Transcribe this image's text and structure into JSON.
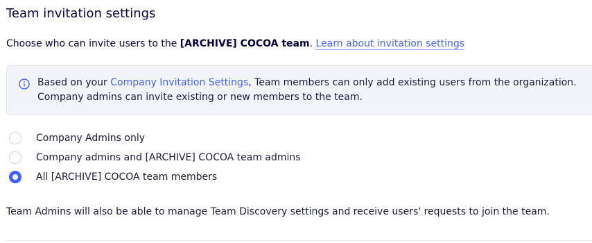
{
  "section": {
    "title": "Team invitation settings"
  },
  "description": {
    "prefix": "Choose who can invite users to the ",
    "team_name": "[ARCHIVE] COCOA team",
    "period": ".",
    "link_label": "Learn about invitation settings"
  },
  "info": {
    "icon": "info-icon",
    "prefix": "Based on your ",
    "link_label": "Company Invitation Settings",
    "suffix": ", Team members can only add existing users from the organization. Company admins can invite existing or new members to the team."
  },
  "options": [
    {
      "label": "Company Admins only",
      "selected": false
    },
    {
      "label": "Company admins and [ARCHIVE] COCOA team admins",
      "selected": false
    },
    {
      "label": "All [ARCHIVE] COCOA team members",
      "selected": true
    }
  ],
  "footer": {
    "note": "Team Admins will also be able to manage Team Discovery settings and receive users' requests to join the team."
  },
  "colors": {
    "accent": "#4262ff",
    "text": "#050038",
    "info_background": "#f3f4fa"
  }
}
